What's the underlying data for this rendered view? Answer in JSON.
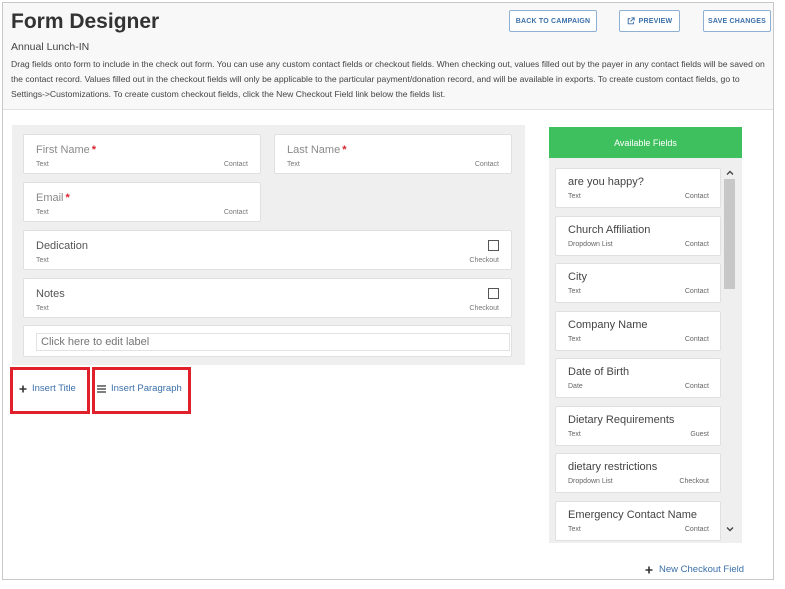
{
  "header": {
    "title": "Form Designer",
    "subtitle": "Annual Lunch-IN",
    "description": "Drag fields onto form to include in the check out form. You can use any custom contact fields or checkout fields. When checking out, values filled out by the payer in any contact fields will be saved on the contact record. Values filled out in the checkout fields will only be applicable to the particular payment/donation record, and will be available in exports. To create custom contact fields, go to Settings->Customizations. To create custom checkout fields, click the New Checkout Field link below the fields list.",
    "buttons": {
      "back": "BACK TO CAMPAIGN",
      "preview": "PREVIEW",
      "save": "SAVE CHANGES"
    }
  },
  "form": {
    "fields": [
      {
        "label": "First Name",
        "required": "*",
        "type": "Text",
        "category": "Contact"
      },
      {
        "label": "Last Name",
        "required": "*",
        "type": "Text",
        "category": "Contact"
      },
      {
        "label": "Email",
        "required": "*",
        "type": "Text",
        "category": "Contact"
      },
      {
        "label": "Dedication",
        "type": "Text",
        "category": "Checkout"
      },
      {
        "label": "Notes",
        "type": "Text",
        "category": "Checkout"
      }
    ],
    "edit_placeholder": "Click here to edit label"
  },
  "actions": {
    "insert_title": "Insert Title",
    "insert_paragraph": "Insert Paragraph",
    "new_checkout_field": "New Checkout Field"
  },
  "available": {
    "heading": "Available Fields",
    "items": [
      {
        "label": "are you happy?",
        "type": "Text",
        "category": "Contact"
      },
      {
        "label": "Church Affiliation",
        "type": "Dropdown List",
        "category": "Contact"
      },
      {
        "label": "City",
        "type": "Text",
        "category": "Contact"
      },
      {
        "label": "Company Name",
        "type": "Text",
        "category": "Contact"
      },
      {
        "label": "Date of Birth",
        "type": "Date",
        "category": "Contact"
      },
      {
        "label": "Dietary Requirements",
        "type": "Text",
        "category": "Guest"
      },
      {
        "label": "dietary restrictions",
        "type": "Dropdown List",
        "category": "Checkout"
      },
      {
        "label": "Emergency Contact Name",
        "type": "Text",
        "category": "Contact"
      }
    ]
  },
  "colors": {
    "accent_green": "#3ec05e",
    "link_blue": "#3b6fa8",
    "highlight_red": "#e0202a",
    "required_red": "#d9232e"
  }
}
